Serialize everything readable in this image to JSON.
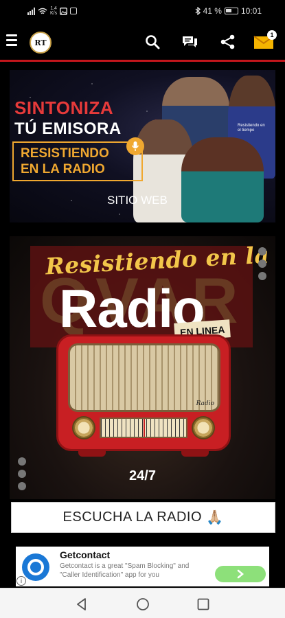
{
  "status_bar": {
    "net_speed_top": "1,4",
    "net_speed_unit": "K/s",
    "battery": "41 %",
    "time": "10:01"
  },
  "header": {
    "logo_text": "RT",
    "message_badge": "1",
    "icons": [
      "menu-icon",
      "search-icon",
      "chat-icon",
      "share-icon",
      "mail-icon"
    ]
  },
  "banner": {
    "line1": "SINTONIZA",
    "line2": "TÚ EMISORA",
    "box_line1": "RESISTIENDO",
    "box_line2": "EN LA RADIO",
    "website_label": "SITIO WEB",
    "shirt_text": "Resistiendo en el tiempo"
  },
  "radio_card": {
    "script_title": "Resistiendo en la",
    "big_title": "Radio",
    "ghost_text": "QVAR",
    "tag": "EN LINEA",
    "radio_brand": "Radio",
    "hours": "24/7"
  },
  "listen_button": {
    "label": "ESCUCHA LA RADIO",
    "emoji": "🙏🏼"
  },
  "ad": {
    "title": "Getcontact",
    "description": "Getcontact is a great \"Spam Blocking\" and \"Caller Identification\" app for you",
    "info": "i"
  },
  "colors": {
    "accent_red": "#c4161c",
    "banner_orange": "#f0a830",
    "banner_red": "#e63a3a",
    "ad_button": "#8de07a"
  }
}
